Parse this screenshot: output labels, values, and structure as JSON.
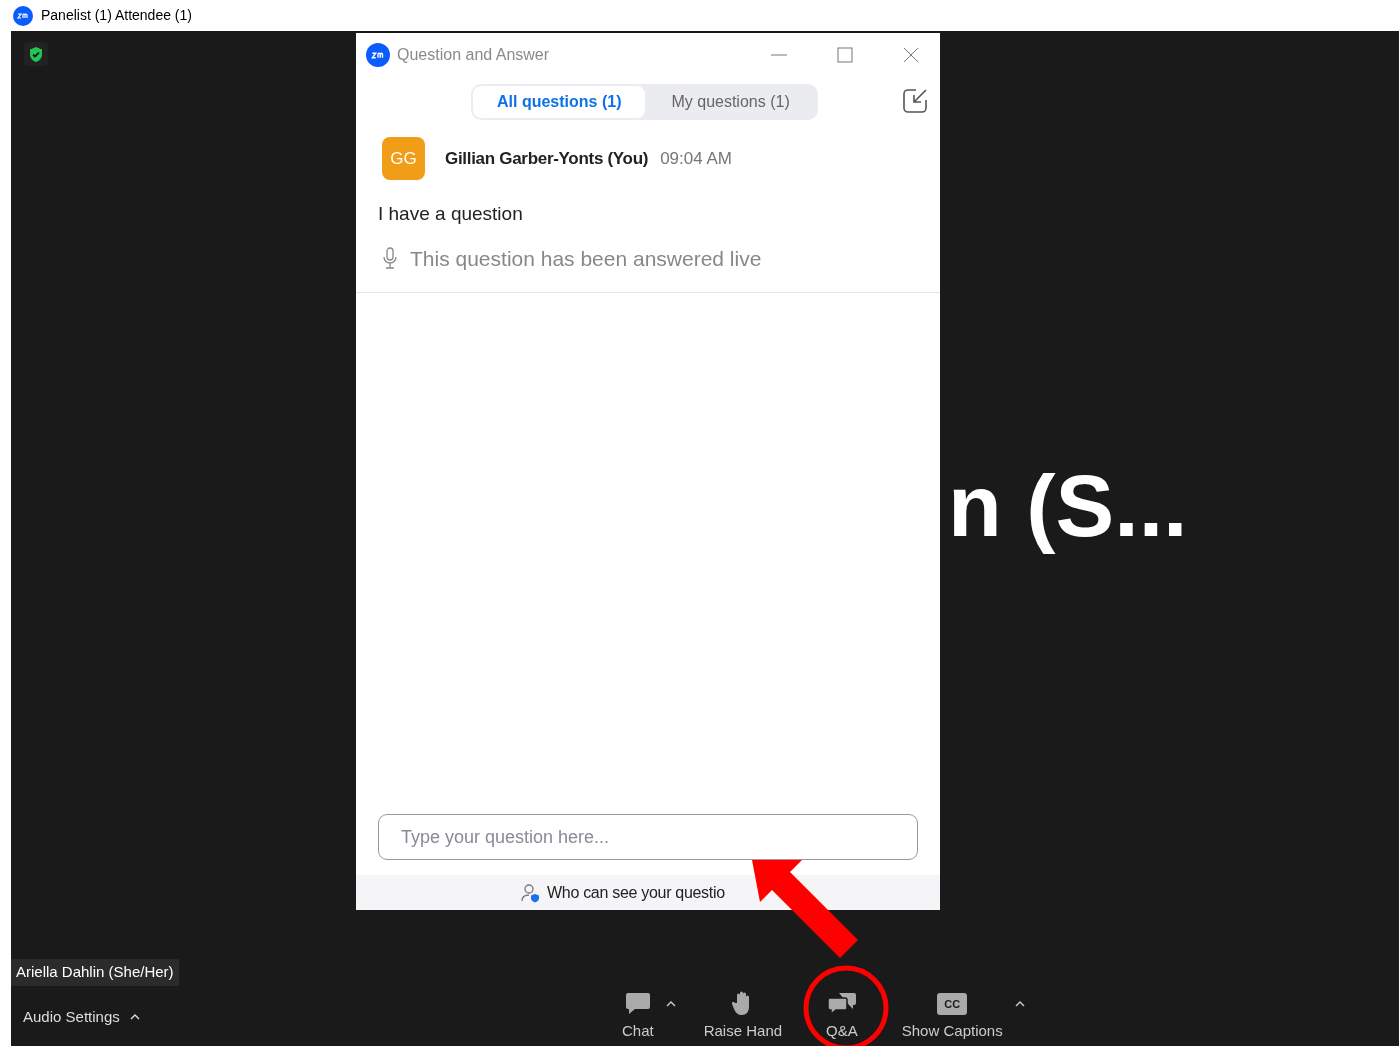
{
  "window": {
    "title": "Panelist (1) Attendee (1)"
  },
  "speaker_name_behind": "n (S...",
  "name_tag": "Ariella Dahlin (She/Her)",
  "audio_settings": "Audio Settings",
  "toolbar": [
    {
      "kind": "chat",
      "label": "Chat",
      "caret": true
    },
    {
      "kind": "hand",
      "label": "Raise Hand",
      "caret": false
    },
    {
      "kind": "qa",
      "label": "Q&A",
      "caret": false
    },
    {
      "kind": "cc",
      "label": "Show Captions",
      "caret": true,
      "badge": "CC"
    }
  ],
  "dialog": {
    "title": "Question and Answer",
    "tabs": [
      {
        "label": "All questions (1)",
        "selected": true
      },
      {
        "label": "My questions (1)",
        "selected": false
      }
    ],
    "questions": [
      {
        "initials": "GG",
        "author": "Gillian Garber-Yonts (You)",
        "time": "09:04 AM",
        "text": "I have a question",
        "status": "This question has been answered live"
      }
    ],
    "input": {
      "placeholder": "Type your question here..."
    },
    "footer": "Who can see your questio"
  }
}
